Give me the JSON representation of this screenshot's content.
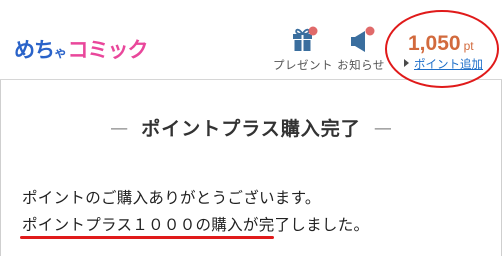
{
  "header": {
    "logo": {
      "part1": "めち",
      "part2": "ゃ",
      "part3": "コミック"
    },
    "nav": {
      "present_label": "プレゼント",
      "notice_label": "お知らせ"
    },
    "points": {
      "value": "1,050",
      "unit": "pt",
      "add_label": "ポイント追加"
    }
  },
  "main": {
    "title": "ポイントプラス購入完了",
    "title_dash": "—",
    "message_line1": "ポイントのご購入ありがとうございます。",
    "message_line2": "ポイントプラス１０００の購入が完了しました。"
  },
  "colors": {
    "logo_blue": "#2a63c9",
    "logo_pink": "#e9479b",
    "points_orange": "#d26a3d",
    "link_blue": "#1e6fc9",
    "icon_blue": "#3a6e9e",
    "badge_red": "#e06a6a",
    "annotation_red": "#e01a1a"
  },
  "icons": {
    "present": "gift-icon",
    "notice": "megaphone-icon",
    "add_points": "triangle-right-icon"
  }
}
